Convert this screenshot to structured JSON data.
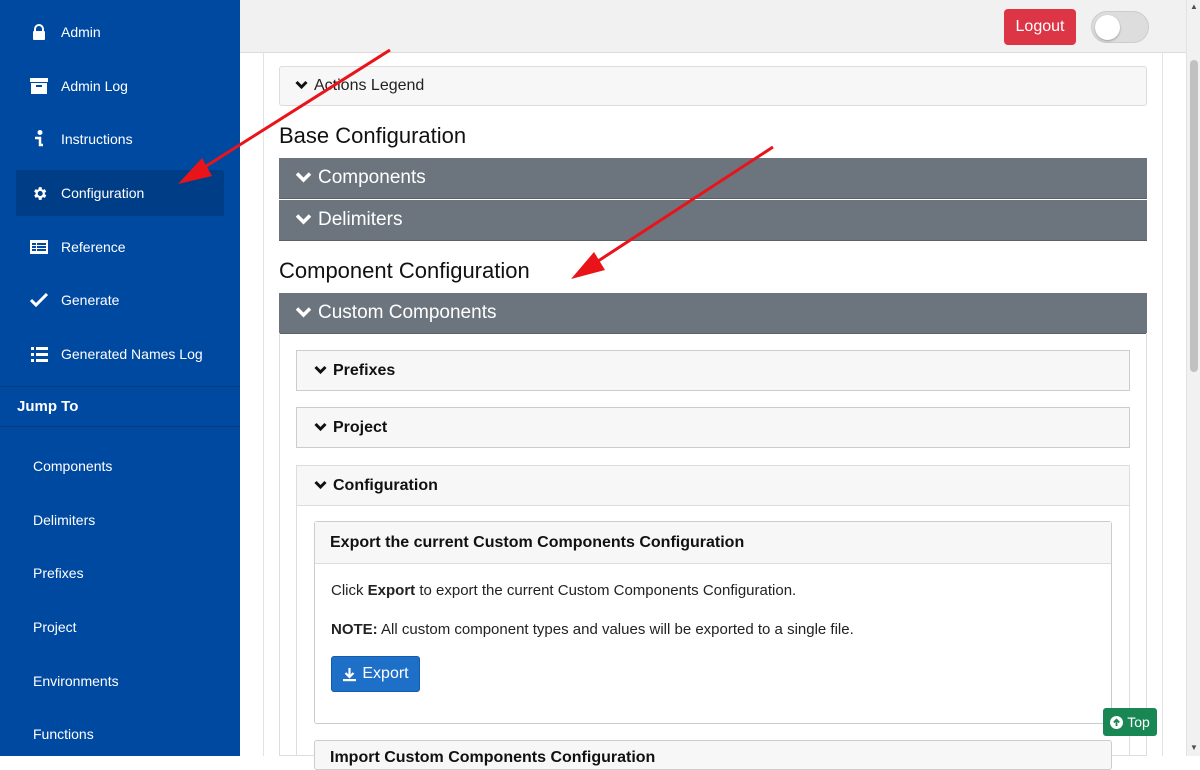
{
  "sidebar": {
    "items": [
      {
        "label": "Admin",
        "icon": "lock-icon"
      },
      {
        "label": "Admin Log",
        "icon": "archive-icon"
      },
      {
        "label": "Instructions",
        "icon": "info-icon"
      },
      {
        "label": "Configuration",
        "icon": "gear-icon",
        "active": true
      },
      {
        "label": "Reference",
        "icon": "table-icon"
      },
      {
        "label": "Generate",
        "icon": "check-icon"
      },
      {
        "label": "Generated Names Log",
        "icon": "list-icon"
      }
    ],
    "jump_to": {
      "header": "Jump To",
      "items": [
        "Components",
        "Delimiters",
        "Prefixes",
        "Project",
        "Environments",
        "Functions"
      ]
    }
  },
  "topbar": {
    "logout_label": "Logout"
  },
  "main": {
    "actions_legend": "Actions Legend",
    "base_title": "Base Configuration",
    "components_label": "Components",
    "delimiters_label": "Delimiters",
    "component_title": "Component Configuration",
    "custom_components_label": "Custom Components",
    "prefixes_label": "Prefixes",
    "project_label": "Project",
    "configuration_label": "Configuration",
    "export_card": {
      "title": "Export the current Custom Components Configuration",
      "line1_pre": "Click ",
      "line1_bold": "Export",
      "line1_post": " to export the current Custom Components Configuration.",
      "line2_bold": "NOTE:",
      "line2_post": " All custom component types and values will be exported to a single file.",
      "export_label": "Export"
    },
    "import_card_title": "Import Custom Components Configuration",
    "top_label": "Top"
  },
  "colors": {
    "sidebar": "#0049a0",
    "gray_bar": "#6c757d",
    "logout": "#dc3545",
    "export": "#1e6fc8",
    "top": "#198754",
    "annotation_arrow": "#e8141a"
  }
}
